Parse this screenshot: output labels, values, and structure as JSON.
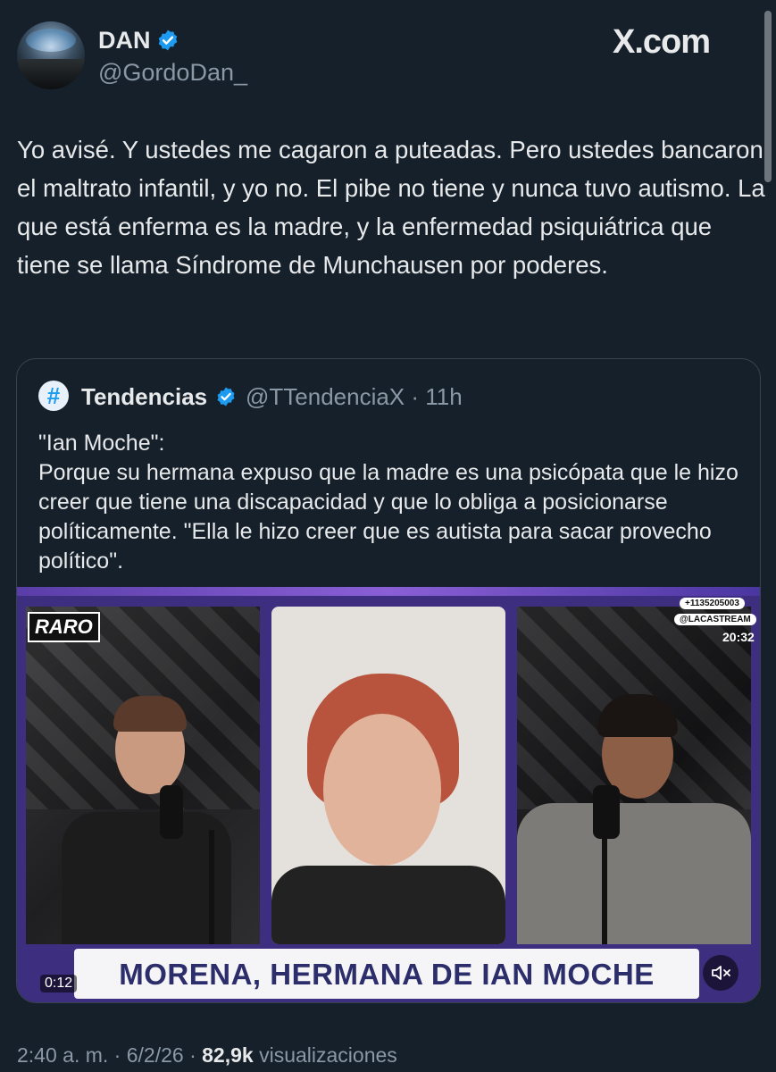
{
  "author": {
    "name": "DAN",
    "handle": "@GordoDan_",
    "verified": true
  },
  "brand": {
    "text": "X.com"
  },
  "tweet": {
    "text": "Yo avisé. Y ustedes me cagaron a puteadas. Pero ustedes bancaron el maltrato infantil, y yo no. El pibe no tiene y nunca tuvo autismo. La que está enferma es la madre, y la enfermedad psiquiátrica que tiene se llama Síndrome de Munchausen por poderes."
  },
  "quote": {
    "avatar_glyph": "#",
    "name": "Tendencias",
    "handle_time": "@TTendenciaX · 11h",
    "verified": true,
    "text": "\"Ian Moche\":\nPorque su hermana expuso que la madre es una psicópata que le hizo creer que tiene una discapacidad y que lo obliga a posicionarse políticamente. \"Ella le hizo creer que es autista para sacar provecho político\"."
  },
  "video": {
    "show_tag": "RARO",
    "phone": "+1135205003",
    "social": "@LACASTREAM",
    "clock": "20:32",
    "lower_third": "MORENA, HERMANA DE IAN MOCHE",
    "duration": "0:12",
    "muted": true
  },
  "meta": {
    "time": "2:40 a. m.",
    "sep1": " · ",
    "date": "6/2/26",
    "sep2": " · ",
    "views_count": "82,9k",
    "views_label": " visualizaciones"
  },
  "colors": {
    "background": "#15202b",
    "text_primary": "#e7e9ea",
    "text_secondary": "#8b98a5",
    "verified_blue": "#1d9bf0",
    "border": "#38444d"
  },
  "icons": {
    "verified": "verified-badge-icon",
    "mute": "speaker-muted-icon"
  }
}
